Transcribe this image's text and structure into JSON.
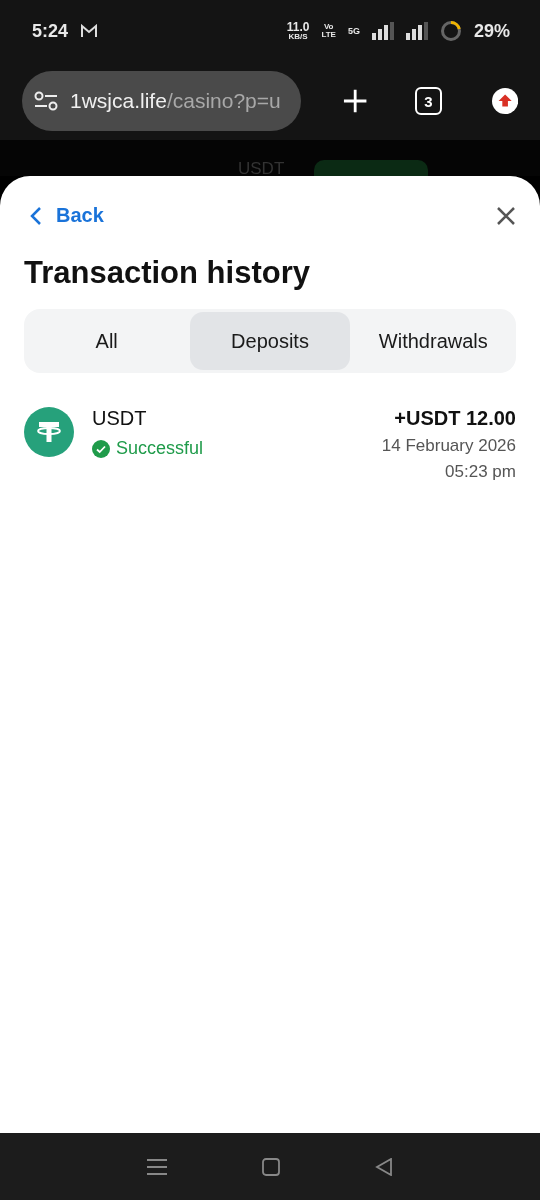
{
  "status_bar": {
    "time": "5:24",
    "net_speed": "11.0",
    "net_unit": "KB/S",
    "volte": "Vo",
    "lte": "LTE",
    "network": "5G",
    "battery": "29%"
  },
  "browser": {
    "url_host": "1wsjca.life",
    "url_path": "/casino?p=u",
    "tab_count": "3"
  },
  "backdrop": {
    "currency": "USDT"
  },
  "sheet": {
    "back": "Back",
    "title": "Transaction history",
    "tabs": [
      {
        "label": "All",
        "selected": false
      },
      {
        "label": "Deposits",
        "selected": true
      },
      {
        "label": "Withdrawals",
        "selected": false
      }
    ],
    "transactions": [
      {
        "currency": "USDT",
        "status": "Successful",
        "successful": true,
        "amount": "+USDT 12.00",
        "date": "14 February 2026",
        "time": "05:23 pm"
      }
    ]
  }
}
